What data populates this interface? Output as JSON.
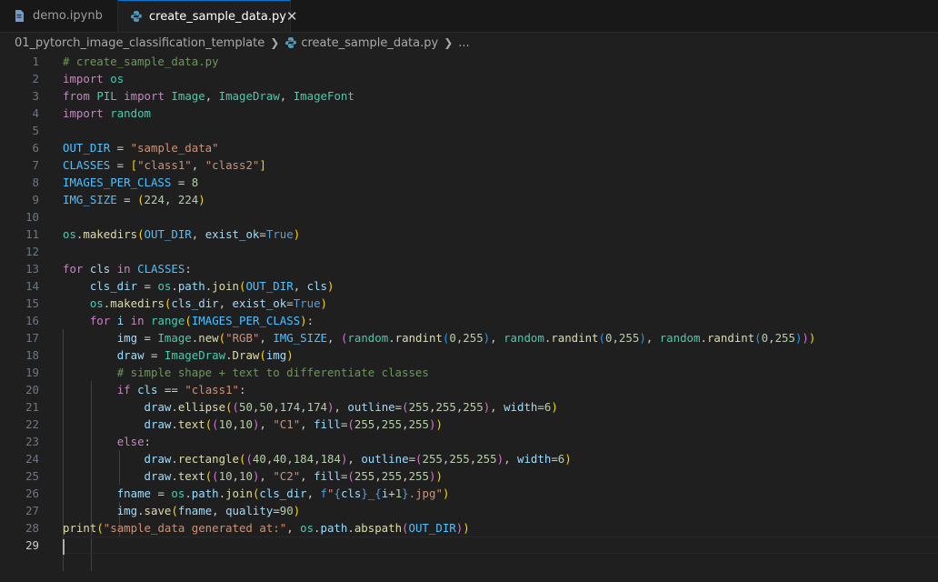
{
  "tabs": [
    {
      "label": "demo.ipynb",
      "icon": "notebook-icon",
      "active": false
    },
    {
      "label": "create_sample_data.py",
      "icon": "python-icon",
      "active": true,
      "close": "✕"
    }
  ],
  "breadcrumb": {
    "folder": "01_pytorch_image_classification_template",
    "file": "create_sample_data.py",
    "more": "..."
  },
  "editor": {
    "line_numbers": [
      "1",
      "2",
      "3",
      "4",
      "5",
      "6",
      "7",
      "8",
      "9",
      "10",
      "11",
      "12",
      "13",
      "14",
      "15",
      "16",
      "17",
      "18",
      "19",
      "20",
      "21",
      "22",
      "23",
      "24",
      "25",
      "26",
      "27",
      "28",
      "29"
    ],
    "current_line": 29
  },
  "colors": {
    "background": "#1f1f1f",
    "keyword_control": "#c586c0",
    "keyword": "#569cd6",
    "variable": "#9cdcfe",
    "constant": "#4fc1ff",
    "string": "#ce9178",
    "number": "#b5cea8",
    "function": "#dcdcaa",
    "class": "#4ec9b0",
    "comment": "#6a9955"
  }
}
